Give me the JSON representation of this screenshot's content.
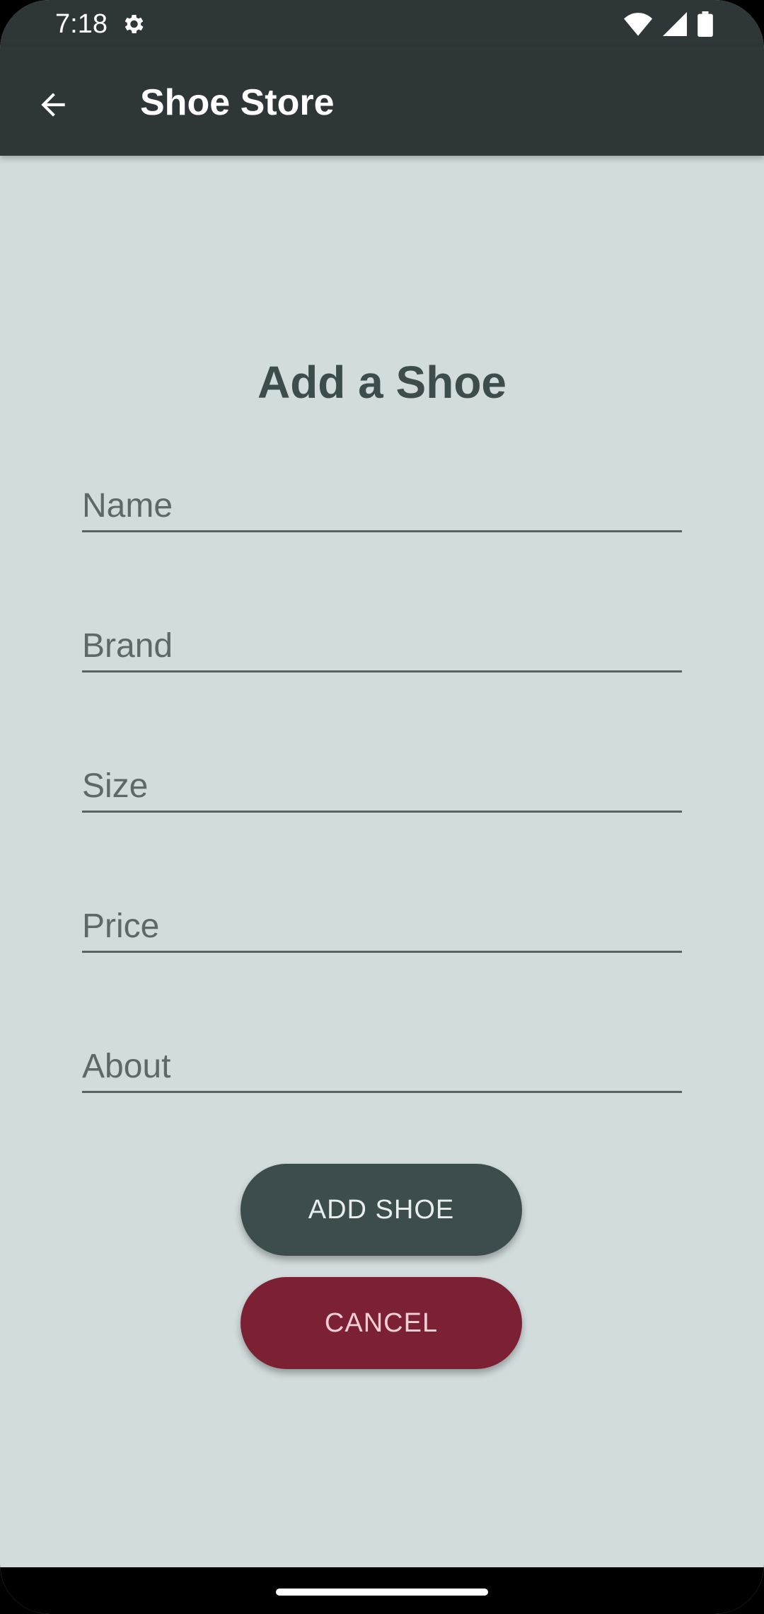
{
  "status_bar": {
    "time": "7:18"
  },
  "app_bar": {
    "title": "Shoe Store"
  },
  "form": {
    "title": "Add a Shoe",
    "fields": [
      {
        "placeholder": "Name",
        "value": ""
      },
      {
        "placeholder": "Brand",
        "value": ""
      },
      {
        "placeholder": "Size",
        "value": ""
      },
      {
        "placeholder": "Price",
        "value": ""
      },
      {
        "placeholder": "About",
        "value": ""
      }
    ],
    "add_label": "ADD SHOE",
    "cancel_label": "CANCEL"
  },
  "colors": {
    "background": "#d3dcdd",
    "app_bar": "#2f3638",
    "primary_button": "#3d4d4d",
    "cancel_button": "#7c2134"
  },
  "icons": {
    "back": "arrow-back-icon",
    "settings": "gear-icon",
    "wifi": "wifi-icon",
    "signal": "signal-icon",
    "battery": "battery-icon"
  }
}
